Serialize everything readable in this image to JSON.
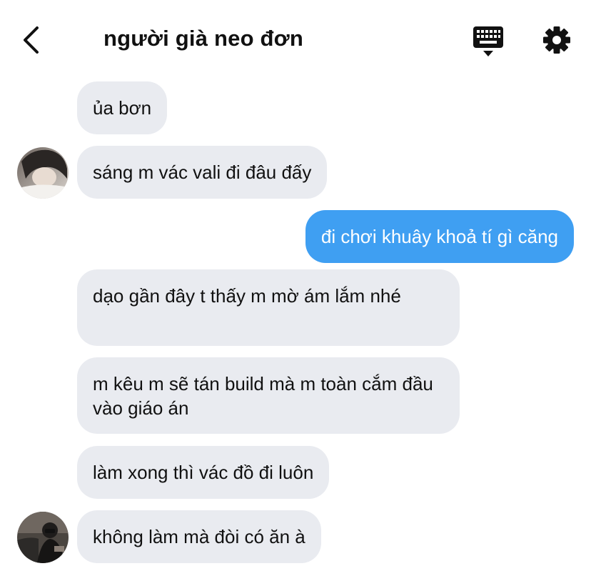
{
  "header": {
    "title": "người già neo đơn",
    "back_icon": "chevron-left-icon",
    "keyboard_icon": "keyboard-icon",
    "settings_icon": "gear-icon"
  },
  "colors": {
    "incoming_bubble": "#e9ebf0",
    "outgoing_bubble": "#3f9ff2",
    "text": "#111111"
  },
  "messages": [
    {
      "direction": "incoming",
      "text": "ủa bơn"
    },
    {
      "direction": "incoming",
      "text": "sáng m vác vali đi đâu đấy"
    },
    {
      "direction": "outgoing",
      "text": "đi chơi khuây khoả tí gì căng"
    },
    {
      "direction": "incoming",
      "text": "dạo gần đây t thấy m mờ ám lắm nhé"
    },
    {
      "direction": "incoming",
      "text": "m kêu m sẽ tán build mà m toàn cắm đầu vào giáo án"
    },
    {
      "direction": "incoming",
      "text": "làm xong thì vác đồ đi luôn"
    },
    {
      "direction": "incoming",
      "text": "không làm mà đòi có ăn à"
    }
  ]
}
